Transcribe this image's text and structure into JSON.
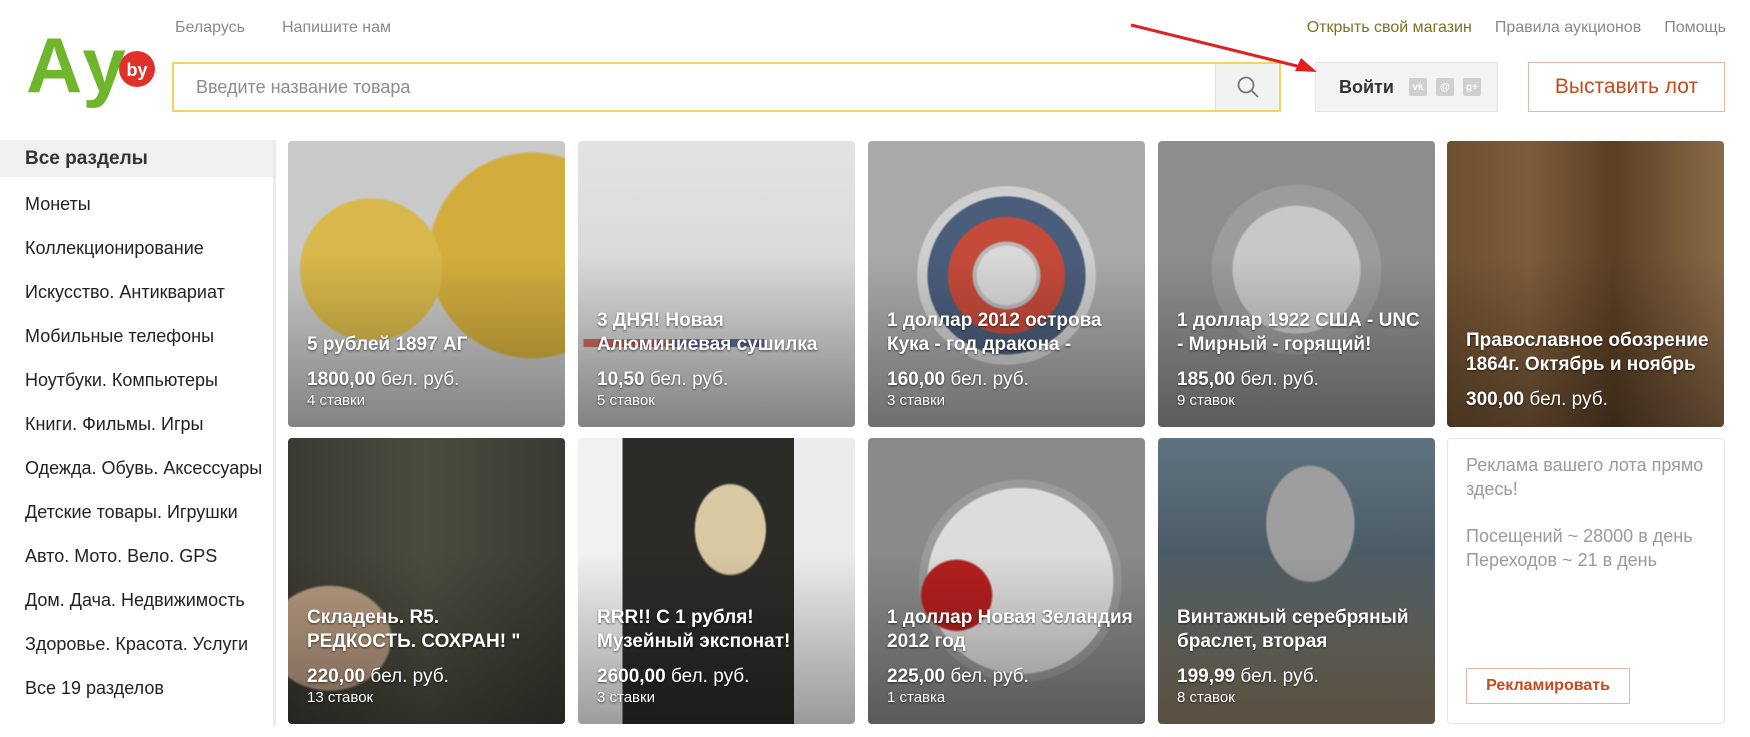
{
  "colors": {
    "accent": "#c64a1c",
    "logo_green": "#6fb62c",
    "logo_red": "#e0302b",
    "search_border": "#f3d45c"
  },
  "logo": {
    "text": "Ау",
    "badge": "by"
  },
  "header": {
    "left_links": [
      "Беларусь",
      "Напишите нам"
    ],
    "right_links": [
      "Открыть свой магазин",
      "Правила аукционов",
      "Помощь"
    ]
  },
  "search": {
    "placeholder": "Введите название товара",
    "icon": "search-icon"
  },
  "login": {
    "label": "Войти",
    "socials": [
      "vk-icon",
      "mail-icon",
      "google-plus-icon"
    ]
  },
  "lot_button": "Выставить лот",
  "sidebar": {
    "all_label": "Все разделы",
    "items": [
      "Монеты",
      "Коллекционирование",
      "Искусство. Антиквариат",
      "Мобильные телефоны",
      "Ноутбуки. Компьютеры",
      "Книги. Фильмы. Игры",
      "Одежда. Обувь. Аксессуары",
      "Детские товары. Игрушки",
      "Авто. Мото. Вело. GPS",
      "Дом. Дача. Недвижимость",
      "Здоровье. Красота. Услуги",
      "Все 19 разделов"
    ]
  },
  "currency": "бел. руб.",
  "lots": [
    {
      "title": "5 рублей 1897 АГ",
      "price": "1800,00",
      "bids": "4 ставки"
    },
    {
      "title": "3 ДНЯ! Новая Алюминиевая сушилка",
      "price": "10,50",
      "bids": "5 ставок"
    },
    {
      "title": "1 доллар 2012 острова Кука - год дракона -",
      "price": "160,00",
      "bids": "3 ставки"
    },
    {
      "title": "1 доллар 1922 США - UNC - Мирный - горящий!",
      "price": "185,00",
      "bids": "9 ставок"
    },
    {
      "title": "Православное обозрение 1864г. Октябрь и ноябрь",
      "price": "300,00",
      "bids": ""
    },
    {
      "title": "Складень. R5. РЕДКОСТЬ. СОХРАН! \"",
      "price": "220,00",
      "bids": "13 ставок"
    },
    {
      "title": "RRR!! С 1 рубля! Музейный экспонат!",
      "price": "2600,00",
      "bids": "3 ставки"
    },
    {
      "title": "1 доллар Новая Зеландия 2012 год",
      "price": "225,00",
      "bids": "1 ставка"
    },
    {
      "title": "Винтажный серебряный браслет, вторая",
      "price": "199,99",
      "bids": "8 ставок"
    }
  ],
  "ad": {
    "line1": "Реклама вашего лота прямо здесь!",
    "line2": "Посещений ~ 28000 в день",
    "line3": "Переходов ~ 21 в день",
    "button": "Рекламировать"
  }
}
